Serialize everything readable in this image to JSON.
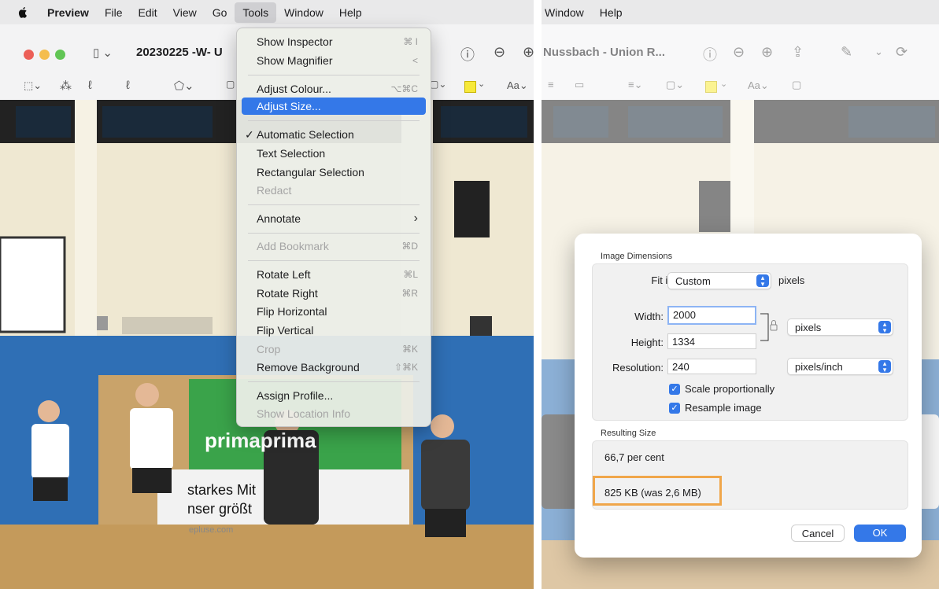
{
  "left": {
    "menubar": {
      "items": [
        "Preview",
        "File",
        "Edit",
        "View",
        "Go",
        "Tools",
        "Window",
        "Help"
      ]
    },
    "window": {
      "title": "20230225 -W- U"
    },
    "tools_menu": {
      "items": [
        {
          "label": "Show Inspector",
          "shortcut": "⌘ I"
        },
        {
          "label": "Show Magnifier",
          "shortcut": "<"
        },
        {
          "label": "Adjust Colour...",
          "shortcut": "⌥⌘C"
        },
        {
          "label": "Adjust Size...",
          "shortcut": ""
        },
        {
          "label": "Automatic Selection",
          "shortcut": "",
          "check": "✓"
        },
        {
          "label": "Text Selection",
          "shortcut": ""
        },
        {
          "label": "Rectangular Selection",
          "shortcut": ""
        },
        {
          "label": "Redact",
          "shortcut": ""
        },
        {
          "label": "Annotate",
          "shortcut": "›"
        },
        {
          "label": "Add Bookmark",
          "shortcut": "⌘D"
        },
        {
          "label": "Rotate Left",
          "shortcut": "⌘L"
        },
        {
          "label": "Rotate Right",
          "shortcut": "⌘R"
        },
        {
          "label": "Flip Horizontal",
          "shortcut": ""
        },
        {
          "label": "Flip Vertical",
          "shortcut": ""
        },
        {
          "label": "Crop",
          "shortcut": "⌘K"
        },
        {
          "label": "Remove Background",
          "shortcut": "⇧⌘K"
        },
        {
          "label": "Assign Profile...",
          "shortcut": ""
        },
        {
          "label": "Show Location Info",
          "shortcut": ""
        }
      ]
    },
    "photo": {
      "banner_texts": [
        "primaprima",
        "starkes Mit",
        "nser größt",
        "epluse.com"
      ]
    }
  },
  "right": {
    "menubar": {
      "items": [
        "Window",
        "Help"
      ]
    },
    "window": {
      "title": "Nussbach - Union R..."
    },
    "dialog": {
      "image_dimensions_label": "Image Dimensions",
      "fit_into_label": "Fit into:",
      "fit_into_value": "Custom",
      "fit_into_unit": "pixels",
      "width_label": "Width:",
      "width_value": "2000",
      "height_label": "Height:",
      "height_value": "1334",
      "size_unit": "pixels",
      "resolution_label": "Resolution:",
      "resolution_value": "240",
      "resolution_unit": "pixels/inch",
      "scale_label": "Scale proportionally",
      "resample_label": "Resample image",
      "resulting_size_label": "Resulting Size",
      "percent_text": "66,7 per cent",
      "size_text": "825 KB (was 2,6 MB)",
      "cancel_label": "Cancel",
      "ok_label": "OK"
    },
    "toolbar2": {
      "font_button": "Aa"
    }
  },
  "colors": {
    "accent": "#3478e8",
    "highlight": "#f0a64a",
    "wall_blue": "#2f6fb5",
    "banner_green": "#3aa34a"
  }
}
